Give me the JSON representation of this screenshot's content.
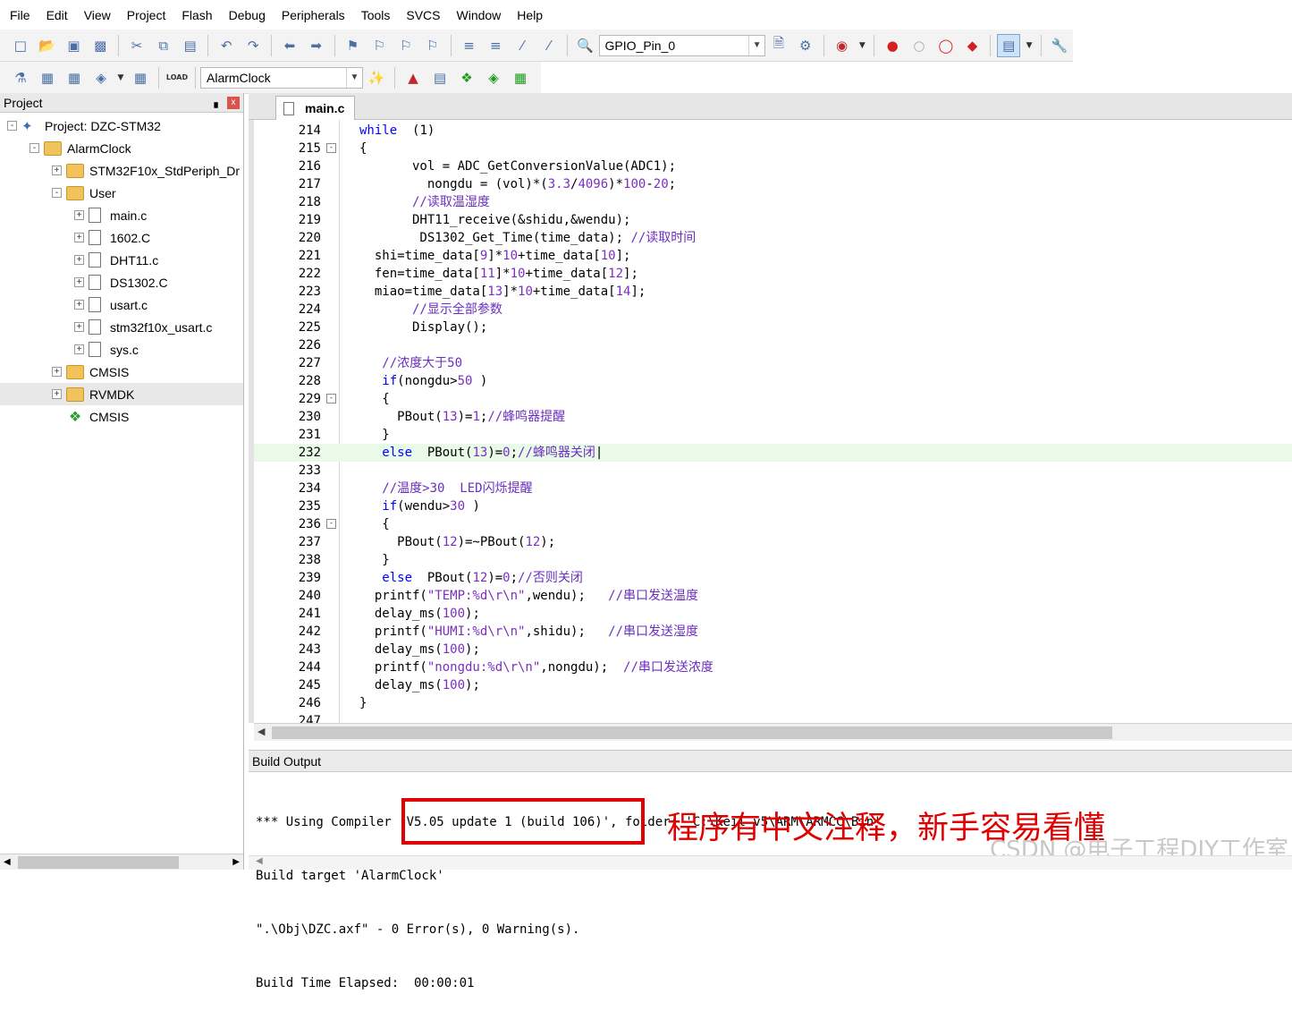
{
  "menu": [
    "File",
    "Edit",
    "View",
    "Project",
    "Flash",
    "Debug",
    "Peripherals",
    "Tools",
    "SVCS",
    "Window",
    "Help"
  ],
  "toolbar": {
    "target_combo": "GPIO_Pin_0",
    "project_combo": "AlarmClock",
    "load_label": "LOAD"
  },
  "project_panel": {
    "title": "Project",
    "pin_icon": "▖",
    "close_icon": "x",
    "items": [
      {
        "label": "Project: DZC-STM32",
        "icon": "project-icon",
        "expander": "-"
      },
      {
        "label": "AlarmClock",
        "icon": "target-icon",
        "expander": "-"
      },
      {
        "label": "STM32F10x_StdPeriph_Dr",
        "icon": "folder-icon",
        "expander": "+"
      },
      {
        "label": "User",
        "icon": "folder-icon",
        "expander": "-"
      },
      {
        "label": "main.c",
        "icon": "file-icon",
        "expander": "+"
      },
      {
        "label": "1602.C",
        "icon": "file-icon",
        "expander": "+"
      },
      {
        "label": "DHT11.c",
        "icon": "file-icon",
        "expander": "+"
      },
      {
        "label": "DS1302.C",
        "icon": "file-icon",
        "expander": "+"
      },
      {
        "label": "usart.c",
        "icon": "file-icon",
        "expander": "+"
      },
      {
        "label": "stm32f10x_usart.c",
        "icon": "file-icon",
        "expander": "+"
      },
      {
        "label": "sys.c",
        "icon": "file-icon",
        "expander": "+"
      },
      {
        "label": "CMSIS",
        "icon": "folder-icon",
        "expander": "+"
      },
      {
        "label": "RVMDK",
        "icon": "folder-icon",
        "expander": "+"
      },
      {
        "label": "CMSIS",
        "icon": "component-icon",
        "expander": ""
      }
    ]
  },
  "editor": {
    "tab": "main.c",
    "lines": [
      {
        "n": "214",
        "fold": "",
        "segs": [
          [
            "kw",
            "while"
          ],
          [
            "",
            "  (1)"
          ]
        ]
      },
      {
        "n": "215",
        "fold": "-",
        "segs": [
          [
            "",
            "{"
          ]
        ]
      },
      {
        "n": "216",
        "fold": "",
        "segs": [
          [
            "",
            "       vol = ADC_GetConversionValue(ADC1);"
          ]
        ]
      },
      {
        "n": "217",
        "fold": "",
        "segs": [
          [
            "",
            "         nongdu = (vol)*("
          ],
          [
            "num",
            "3.3"
          ],
          [
            "",
            "/"
          ],
          [
            "num",
            "4096"
          ],
          [
            "",
            ")*"
          ],
          [
            "num",
            "100"
          ],
          [
            "",
            "-"
          ],
          [
            "num",
            "20"
          ],
          [
            "",
            ";"
          ]
        ]
      },
      {
        "n": "218",
        "fold": "",
        "segs": [
          [
            "cm",
            "       //读取温湿度"
          ]
        ]
      },
      {
        "n": "219",
        "fold": "",
        "segs": [
          [
            "",
            "       DHT11_receive(&shidu,&wendu);"
          ]
        ]
      },
      {
        "n": "220",
        "fold": "",
        "segs": [
          [
            "",
            "        DS1302_Get_Time(time_data); "
          ],
          [
            "cm",
            "//读取时间"
          ]
        ]
      },
      {
        "n": "221",
        "fold": "",
        "segs": [
          [
            "",
            "  shi=time_data["
          ],
          [
            "num",
            "9"
          ],
          [
            "",
            "]*"
          ],
          [
            "num",
            "10"
          ],
          [
            "",
            "+time_data["
          ],
          [
            "num",
            "10"
          ],
          [
            "",
            "];"
          ]
        ]
      },
      {
        "n": "222",
        "fold": "",
        "segs": [
          [
            "",
            "  fen=time_data["
          ],
          [
            "num",
            "11"
          ],
          [
            "",
            "]*"
          ],
          [
            "num",
            "10"
          ],
          [
            "",
            "+time_data["
          ],
          [
            "num",
            "12"
          ],
          [
            "",
            "];"
          ]
        ]
      },
      {
        "n": "223",
        "fold": "",
        "segs": [
          [
            "",
            "  miao=time_data["
          ],
          [
            "num",
            "13"
          ],
          [
            "",
            "]*"
          ],
          [
            "num",
            "10"
          ],
          [
            "",
            "+time_data["
          ],
          [
            "num",
            "14"
          ],
          [
            "",
            "];"
          ]
        ]
      },
      {
        "n": "224",
        "fold": "",
        "segs": [
          [
            "cm",
            "       //显示全部参数"
          ]
        ]
      },
      {
        "n": "225",
        "fold": "",
        "segs": [
          [
            "",
            "       Display();"
          ]
        ]
      },
      {
        "n": "226",
        "fold": "",
        "segs": [
          [
            "",
            ""
          ]
        ]
      },
      {
        "n": "227",
        "fold": "",
        "segs": [
          [
            "cm",
            "   //浓度大于50"
          ]
        ]
      },
      {
        "n": "228",
        "fold": "",
        "segs": [
          [
            "",
            "   "
          ],
          [
            "kw",
            "if"
          ],
          [
            "",
            "(nongdu>"
          ],
          [
            "num",
            "50"
          ],
          [
            "",
            " )"
          ]
        ]
      },
      {
        "n": "229",
        "fold": "-",
        "segs": [
          [
            "",
            "   {"
          ]
        ]
      },
      {
        "n": "230",
        "fold": "",
        "segs": [
          [
            "",
            "     PBout("
          ],
          [
            "num",
            "13"
          ],
          [
            "",
            ")="
          ],
          [
            "num",
            "1"
          ],
          [
            "",
            ";"
          ],
          [
            "cm",
            "//蜂鸣器提醒"
          ]
        ]
      },
      {
        "n": "231",
        "fold": "",
        "segs": [
          [
            "",
            "   }"
          ]
        ]
      },
      {
        "n": "232",
        "fold": "",
        "hl": true,
        "segs": [
          [
            "",
            "   "
          ],
          [
            "kw",
            "else"
          ],
          [
            "",
            "  PBout("
          ],
          [
            "num",
            "13"
          ],
          [
            "",
            ")="
          ],
          [
            "num",
            "0"
          ],
          [
            "",
            ";"
          ],
          [
            "cm",
            "//蜂鸣器关闭"
          ],
          [
            "",
            "|"
          ]
        ]
      },
      {
        "n": "233",
        "fold": "",
        "segs": [
          [
            "",
            ""
          ]
        ]
      },
      {
        "n": "234",
        "fold": "",
        "segs": [
          [
            "cm",
            "   //温度>30  LED闪烁提醒"
          ]
        ]
      },
      {
        "n": "235",
        "fold": "",
        "segs": [
          [
            "",
            "   "
          ],
          [
            "kw",
            "if"
          ],
          [
            "",
            "(wendu>"
          ],
          [
            "num",
            "30"
          ],
          [
            "",
            " )"
          ]
        ]
      },
      {
        "n": "236",
        "fold": "-",
        "segs": [
          [
            "",
            "   {"
          ]
        ]
      },
      {
        "n": "237",
        "fold": "",
        "segs": [
          [
            "",
            "     PBout("
          ],
          [
            "num",
            "12"
          ],
          [
            "",
            ")=~PBout("
          ],
          [
            "num",
            "12"
          ],
          [
            "",
            ");"
          ]
        ]
      },
      {
        "n": "238",
        "fold": "",
        "segs": [
          [
            "",
            "   }"
          ]
        ]
      },
      {
        "n": "239",
        "fold": "",
        "segs": [
          [
            "",
            "   "
          ],
          [
            "kw",
            "else"
          ],
          [
            "",
            "  PBout("
          ],
          [
            "num",
            "12"
          ],
          [
            "",
            ")="
          ],
          [
            "num",
            "0"
          ],
          [
            "",
            ";"
          ],
          [
            "cm",
            "//否则关闭"
          ]
        ]
      },
      {
        "n": "240",
        "fold": "",
        "segs": [
          [
            "",
            "  printf("
          ],
          [
            "str",
            "\"TEMP:%d\\r\\n\""
          ],
          [
            "",
            ",wendu);   "
          ],
          [
            "cm",
            "//串口发送温度"
          ]
        ]
      },
      {
        "n": "241",
        "fold": "",
        "segs": [
          [
            "",
            "  delay_ms("
          ],
          [
            "num",
            "100"
          ],
          [
            "",
            ");"
          ]
        ]
      },
      {
        "n": "242",
        "fold": "",
        "segs": [
          [
            "",
            "  printf("
          ],
          [
            "str",
            "\"HUMI:%d\\r\\n\""
          ],
          [
            "",
            ",shidu);   "
          ],
          [
            "cm",
            "//串口发送湿度"
          ]
        ]
      },
      {
        "n": "243",
        "fold": "",
        "segs": [
          [
            "",
            "  delay_ms("
          ],
          [
            "num",
            "100"
          ],
          [
            "",
            ");"
          ]
        ]
      },
      {
        "n": "244",
        "fold": "",
        "segs": [
          [
            "",
            "  printf("
          ],
          [
            "str",
            "\"nongdu:%d\\r\\n\""
          ],
          [
            "",
            ",nongdu);  "
          ],
          [
            "cm",
            "//串口发送浓度"
          ]
        ]
      },
      {
        "n": "245",
        "fold": "",
        "segs": [
          [
            "",
            "  delay_ms("
          ],
          [
            "num",
            "100"
          ],
          [
            "",
            ");"
          ]
        ]
      },
      {
        "n": "246",
        "fold": "",
        "segs": [
          [
            "",
            "}"
          ]
        ]
      },
      {
        "n": "247",
        "fold": "",
        "segs": [
          [
            "",
            ""
          ]
        ]
      }
    ]
  },
  "build_output": {
    "title": "Build Output",
    "lines": [
      "*** Using Compiler 'V5.05 update 1 (build 106)', folder: 'C:\\Keil_v5\\ARM\\ARMCC\\Bin'",
      "Build target 'AlarmClock'",
      "\".\\Obj\\DZC.axf\" - 0 Error(s), 0 Warning(s).",
      "Build Time Elapsed:  00:00:01"
    ],
    "annotation": "程序有中文注释，新手容易看懂",
    "watermark": "CSDN @电子工程DIY工作室"
  }
}
